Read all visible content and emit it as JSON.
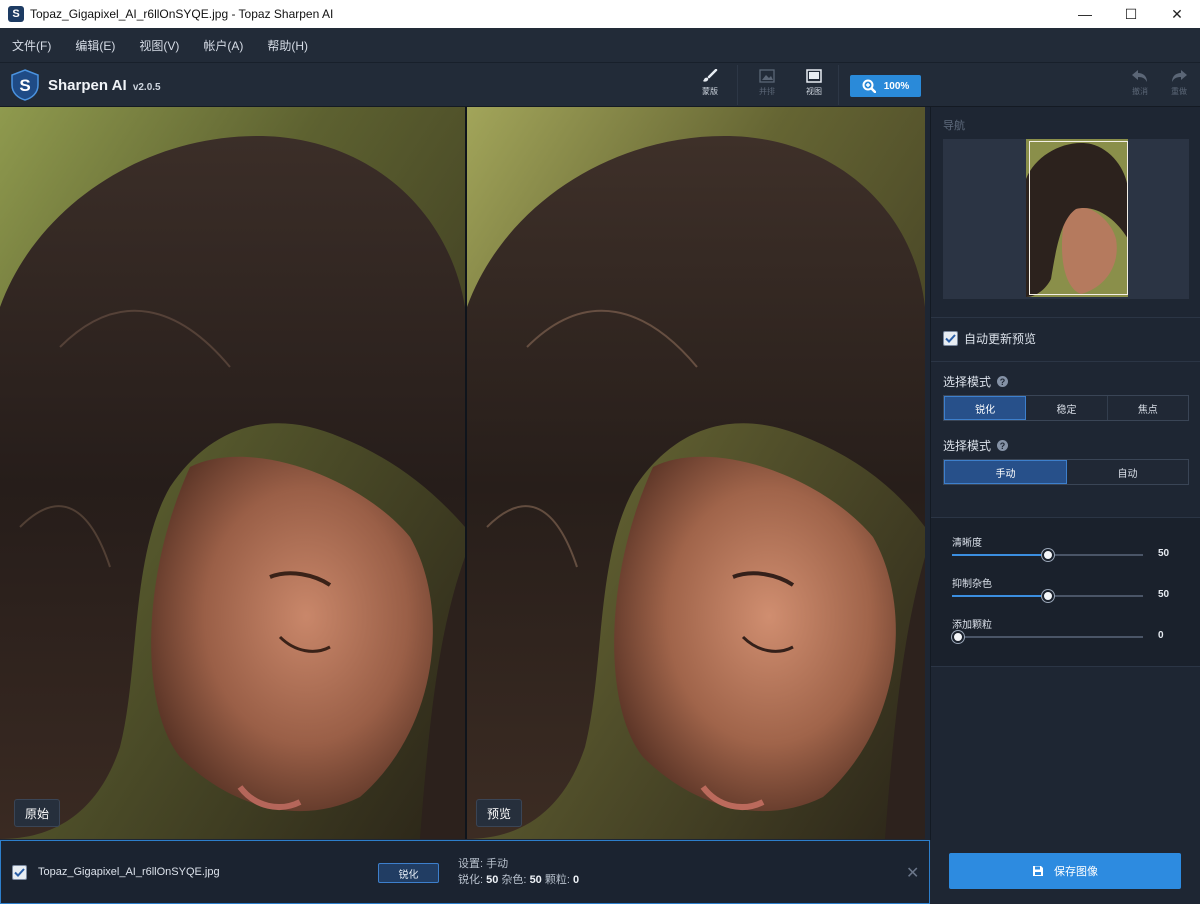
{
  "window": {
    "title": "Topaz_Gigapixel_AI_r6llOnSYQE.jpg - Topaz Sharpen AI",
    "minimize": "—",
    "maximize": "☐",
    "close": "✕"
  },
  "menu": [
    "文件(F)",
    "编辑(E)",
    "视图(V)",
    "帐户(A)",
    "帮助(H)"
  ],
  "brand": {
    "name": "Sharpen AI",
    "version": "v2.0.5"
  },
  "toolbar": {
    "mask_label": "蒙版",
    "compare_label": "并排",
    "view_label": "视图",
    "zoom_label": "100%",
    "undo_label": "撤消",
    "redo_label": "重做"
  },
  "panes": {
    "original_label": "原始",
    "preview_label": "预览"
  },
  "side": {
    "nav_title": "导航",
    "auto_update_label": "自动更新预览",
    "auto_update_checked": true,
    "mode_title": "选择模式",
    "modes": [
      "锐化",
      "稳定",
      "焦点"
    ],
    "active_mode": "锐化",
    "method_title": "选择模式",
    "methods": [
      "手动",
      "自动"
    ],
    "active_method": "手动",
    "sliders": [
      {
        "label": "清晰度",
        "value": "50",
        "fraction": 0.5
      },
      {
        "label": "抑制杂色",
        "value": "50",
        "fraction": 0.5
      },
      {
        "label": "添加颗粒",
        "value": "0",
        "fraction": 0.0
      }
    ]
  },
  "file": {
    "checked": true,
    "name": "Topaz_Gigapixel_AI_r6llOnSYQE.jpg",
    "mode_badge": "锐化",
    "setting_line": "设置: 手动",
    "sharpen_label": "锐化:",
    "sharpen_value": "50",
    "noise_label": "杂色:",
    "noise_value": "50",
    "grain_label": "颗粒:",
    "grain_value": "0"
  },
  "save_label": "保存图像"
}
